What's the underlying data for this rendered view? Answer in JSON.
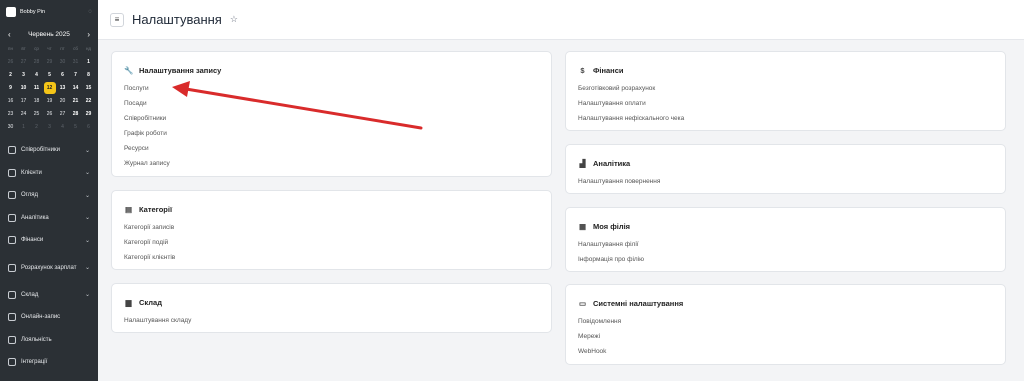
{
  "sidebar": {
    "brand": "Bobby Pin",
    "calendar": {
      "title": "Червень 2025",
      "weekdays": [
        "пн",
        "вт",
        "ср",
        "чт",
        "пт",
        "сб",
        "нд"
      ],
      "rows": [
        [
          "26",
          "27",
          "28",
          "29",
          "30",
          "31",
          "1"
        ],
        [
          "2",
          "3",
          "4",
          "5",
          "6",
          "7",
          "8"
        ],
        [
          "9",
          "10",
          "11",
          "12",
          "13",
          "14",
          "15"
        ],
        [
          "16",
          "17",
          "18",
          "19",
          "20",
          "21",
          "22"
        ],
        [
          "23",
          "24",
          "25",
          "26",
          "27",
          "28",
          "29"
        ],
        [
          "30",
          "1",
          "2",
          "3",
          "4",
          "5",
          "6"
        ]
      ],
      "today": "12"
    },
    "menu": [
      {
        "label": "Співробітники",
        "icon": "user-icon",
        "chevron": true
      },
      {
        "label": "Клієнти",
        "icon": "users-icon",
        "chevron": true
      },
      {
        "label": "Огляд",
        "icon": "grid-icon",
        "chevron": true
      },
      {
        "label": "Аналітика",
        "icon": "chart-icon",
        "chevron": true
      },
      {
        "label": "Фінанси",
        "icon": "dollar-icon",
        "chevron": true
      },
      {
        "label": "Розрахунок зарплат",
        "icon": "document-icon",
        "chevron": true,
        "tall": true
      },
      {
        "label": "Склад",
        "icon": "box-icon",
        "chevron": true
      },
      {
        "label": "Онлайн-запис",
        "icon": "globe-icon",
        "chevron": false
      },
      {
        "label": "Лояльність",
        "icon": "card-icon",
        "chevron": false
      },
      {
        "label": "Інтеграції",
        "icon": "plug-icon",
        "chevron": false
      }
    ]
  },
  "header": {
    "title": "Налаштування"
  },
  "cards": {
    "booking": {
      "title": "Налаштування запису",
      "links": [
        "Послуги",
        "Посади",
        "Співробітники",
        "Графік роботи",
        "Ресурси",
        "Журнал запису"
      ]
    },
    "categories": {
      "title": "Категорії",
      "links": [
        "Категорії записів",
        "Категорії подій",
        "Категорії клієнтів"
      ]
    },
    "warehouse": {
      "title": "Склад",
      "links": [
        "Налаштування складу"
      ]
    },
    "finance": {
      "title": "Фінанси",
      "links": [
        "Безготівковий розрахунок",
        "Налаштування оплати",
        "Налаштування нефіскального чека"
      ]
    },
    "analytics": {
      "title": "Аналітика",
      "links": [
        "Налаштування повернення"
      ]
    },
    "branch": {
      "title": "Моя філія",
      "links": [
        "Налаштування філії",
        "Інформація про філію"
      ]
    },
    "system": {
      "title": "Системні налаштування",
      "links": [
        "Повідомлення",
        "Мережі",
        "WebHook"
      ]
    }
  },
  "colors": {
    "sidebar_bg": "#2b3035",
    "today_highlight": "#f5c518",
    "annotation_arrow": "#d92b2b"
  }
}
